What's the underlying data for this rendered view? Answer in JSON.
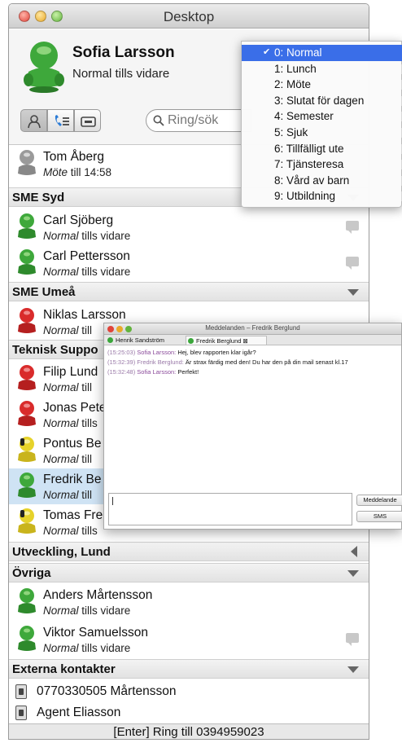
{
  "window": {
    "title": "Desktop"
  },
  "profile": {
    "name": "Sofia Larsson",
    "status": "Normal tills vidare",
    "avatar_color": "green"
  },
  "toolbar": {
    "search_placeholder": "Ring/sök"
  },
  "status_menu": [
    {
      "label": "0: Normal",
      "selected": true
    },
    {
      "label": "1: Lunch"
    },
    {
      "label": "2: Möte"
    },
    {
      "label": "3: Slutat för dagen"
    },
    {
      "label": "4: Semester"
    },
    {
      "label": "5: Sjuk"
    },
    {
      "label": "6: Tillfälligt ute"
    },
    {
      "label": "7: Tjänsteresa"
    },
    {
      "label": "8: Vård av barn"
    },
    {
      "label": "9: Utbildning"
    }
  ],
  "groups": {
    "sme_syd": "SME Syd",
    "sme_umea": "SME Umeå",
    "teknisk_support": "Teknisk Suppo",
    "utveckling_lund": "Utveckling, Lund",
    "ovriga": "Övriga",
    "externa": "Externa kontakter"
  },
  "contacts": {
    "tom": {
      "name": "Tom Åberg",
      "status_state": "Möte",
      "status_rest": " till 14:58",
      "color": "gray"
    },
    "carl_s": {
      "name": "Carl Sjöberg",
      "status_state": "Normal",
      "status_rest": " tills vidare",
      "color": "green"
    },
    "carl_p": {
      "name": "Carl Pettersson",
      "status_state": "Normal",
      "status_rest": " tills vidare",
      "color": "green"
    },
    "niklas": {
      "name": "Niklas Larsson",
      "status_state": "Normal",
      "status_rest": " till",
      "color": "red"
    },
    "filip": {
      "name": "Filip Lund",
      "status_state": "Normal",
      "status_rest": " till",
      "color": "red"
    },
    "jonas": {
      "name": "Jonas Pete",
      "status_state": "Normal",
      "status_rest": " tills",
      "color": "red"
    },
    "pontus": {
      "name": "Pontus Be",
      "status_state": "Normal",
      "status_rest": " till",
      "color": "yellow"
    },
    "fredrik": {
      "name": "Fredrik Be",
      "status_state": "Normal",
      "status_rest": " till",
      "color": "green"
    },
    "tomas": {
      "name": "Tomas Fre",
      "status_state": "Normal",
      "status_rest": " tills",
      "color": "yellow"
    },
    "anders": {
      "name": "Anders Mårtensson",
      "status_state": "Normal",
      "status_rest": " tills vidare",
      "color": "green"
    },
    "viktor": {
      "name": "Viktor Samuelsson",
      "status_state": "Normal",
      "status_rest": " tills vidare",
      "color": "green"
    }
  },
  "external": [
    "0770330505 Mårtensson",
    "Agent Eliasson"
  ],
  "footer": "[Enter] Ring till 0394959023",
  "messages_window": {
    "title": "Meddelanden – Fredrik Berglund",
    "tabs": [
      "Henrik Sandström",
      "Fredrik Berglund ⊠"
    ],
    "lines": [
      {
        "time": "(15:25:03)",
        "sender": "Sofia Larsson:",
        "text": "Hej, blev rapporten klar igår?"
      },
      {
        "time": "(15:32:39)",
        "sender": "Fredrik Berglund:",
        "text": "Är strax färdig med den! Du har den på din mail senast kl.17"
      },
      {
        "time": "(15:32:48)",
        "sender": "Sofia Larsson:",
        "text": "Perfekt!"
      }
    ],
    "send_button": "Meddelande",
    "sms_button": "SMS"
  }
}
